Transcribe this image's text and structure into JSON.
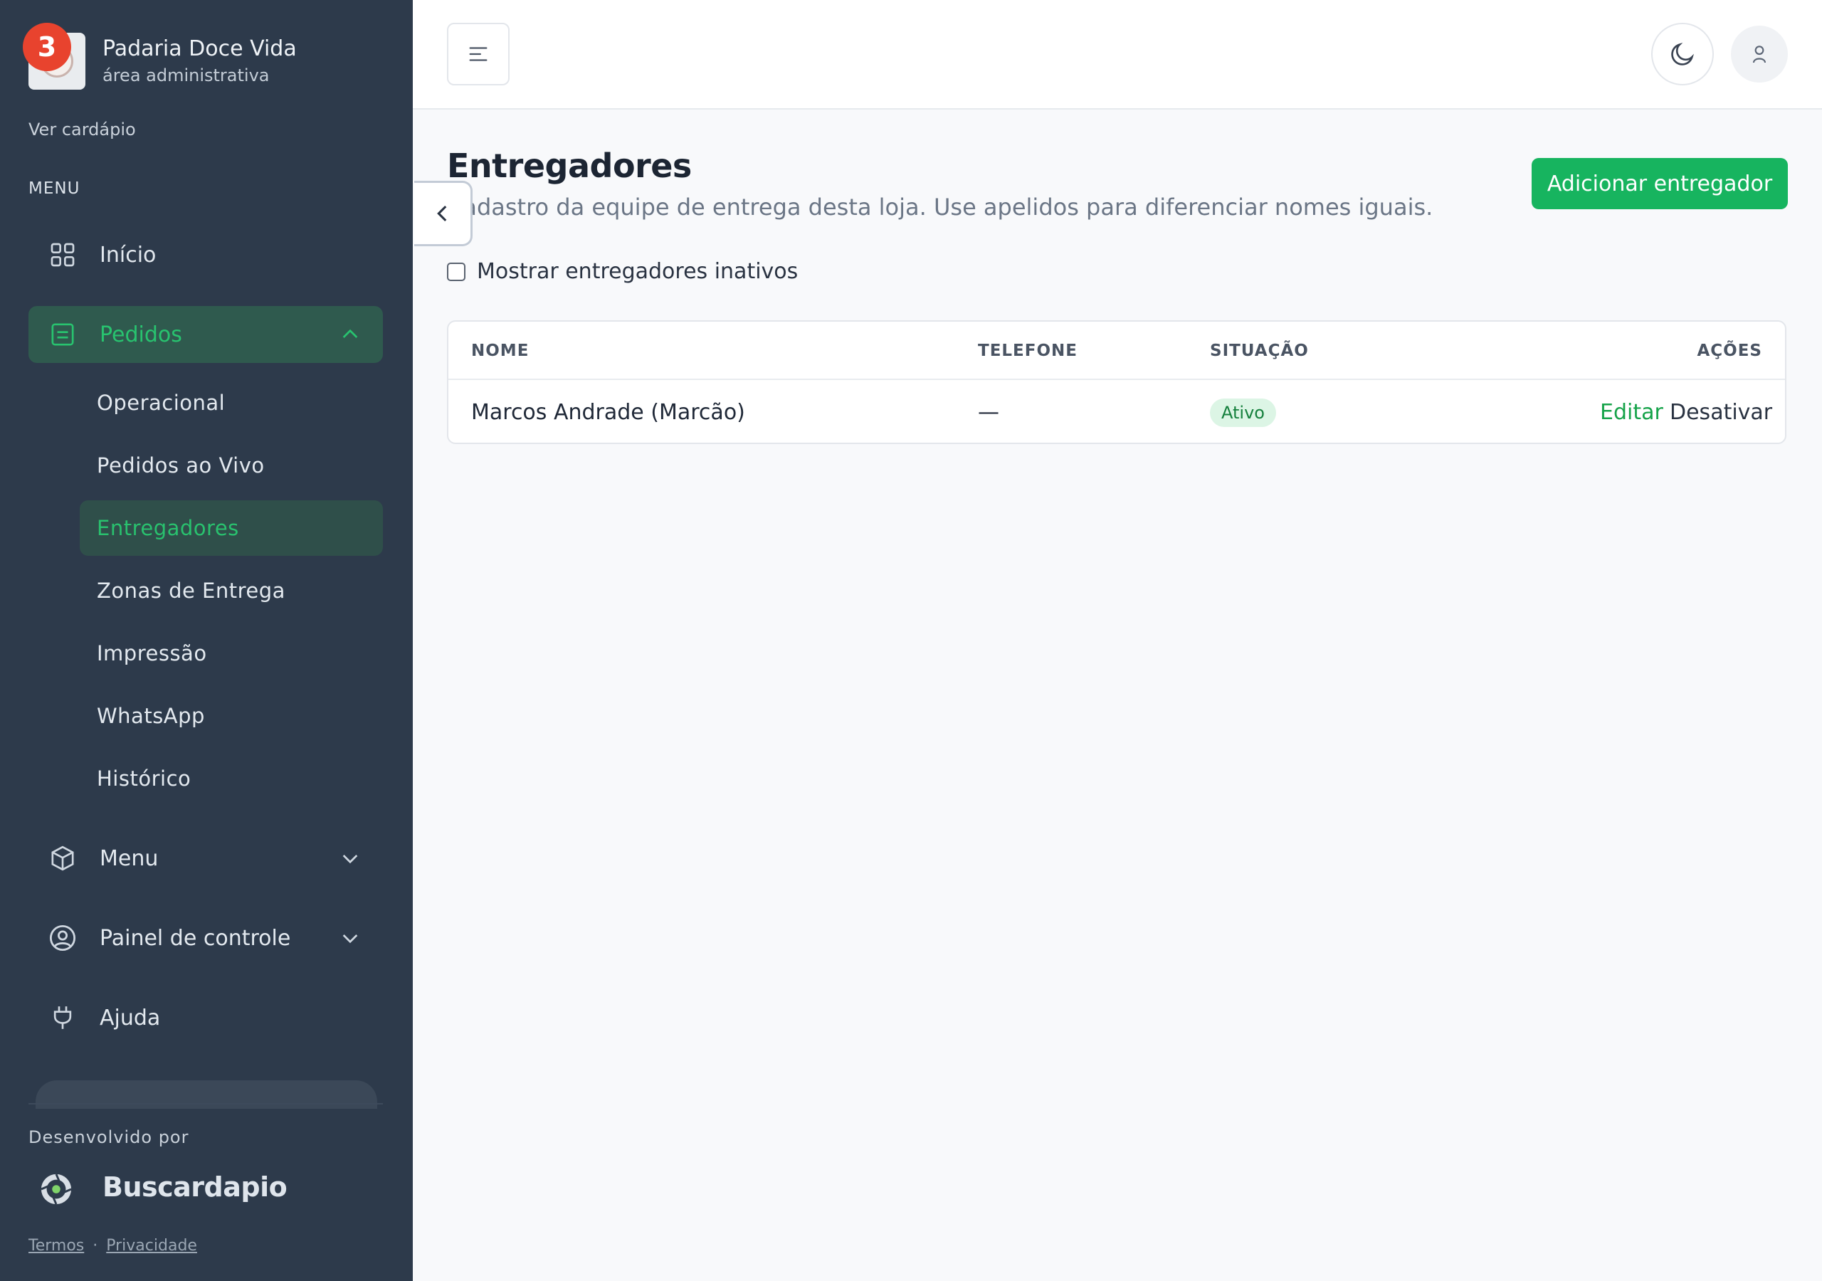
{
  "brand": {
    "name": "Padaria Doce Vida",
    "subtitle": "área administrativa",
    "notification_count": "3",
    "view_menu_link": "Ver cardápio"
  },
  "sidebar": {
    "section_label": "MENU",
    "items": [
      {
        "label": "Início",
        "icon": "grid-icon"
      },
      {
        "label": "Pedidos",
        "icon": "list-icon",
        "expanded": true
      },
      {
        "label": "Menu",
        "icon": "cube-icon"
      },
      {
        "label": "Painel de controle",
        "icon": "user-circle-icon"
      },
      {
        "label": "Ajuda",
        "icon": "plug-icon"
      }
    ],
    "sub_items": [
      {
        "label": "Operacional"
      },
      {
        "label": "Pedidos ao Vivo"
      },
      {
        "label": "Entregadores",
        "active": true
      },
      {
        "label": "Zonas de Entrega"
      },
      {
        "label": "Impressão"
      },
      {
        "label": "WhatsApp"
      },
      {
        "label": "Histórico"
      }
    ],
    "footer": {
      "developed_by": "Desenvolvido por",
      "developer_name": "Buscardapio",
      "terms": "Termos",
      "separator": "·",
      "privacy": "Privacidade"
    }
  },
  "page": {
    "title": "Entregadores",
    "description": "Cadastro da equipe de entrega desta loja. Use apelidos para diferenciar nomes iguais.",
    "add_button": "Adicionar entregador",
    "show_inactive_label": "Mostrar entregadores inativos",
    "show_inactive_checked": false
  },
  "table": {
    "headers": {
      "name": "NOME",
      "phone": "TELEFONE",
      "status": "SITUAÇÃO",
      "actions": "AÇÕES"
    },
    "rows": [
      {
        "name": "Marcos Andrade (Marcão)",
        "phone": "—",
        "status": "Ativo",
        "edit": "Editar",
        "deactivate": "Desativar"
      }
    ]
  },
  "colors": {
    "sidebar_bg": "#2d3a4b",
    "accent_green": "#17b45f",
    "active_text": "#28c36f",
    "badge_red": "#e8432e"
  }
}
